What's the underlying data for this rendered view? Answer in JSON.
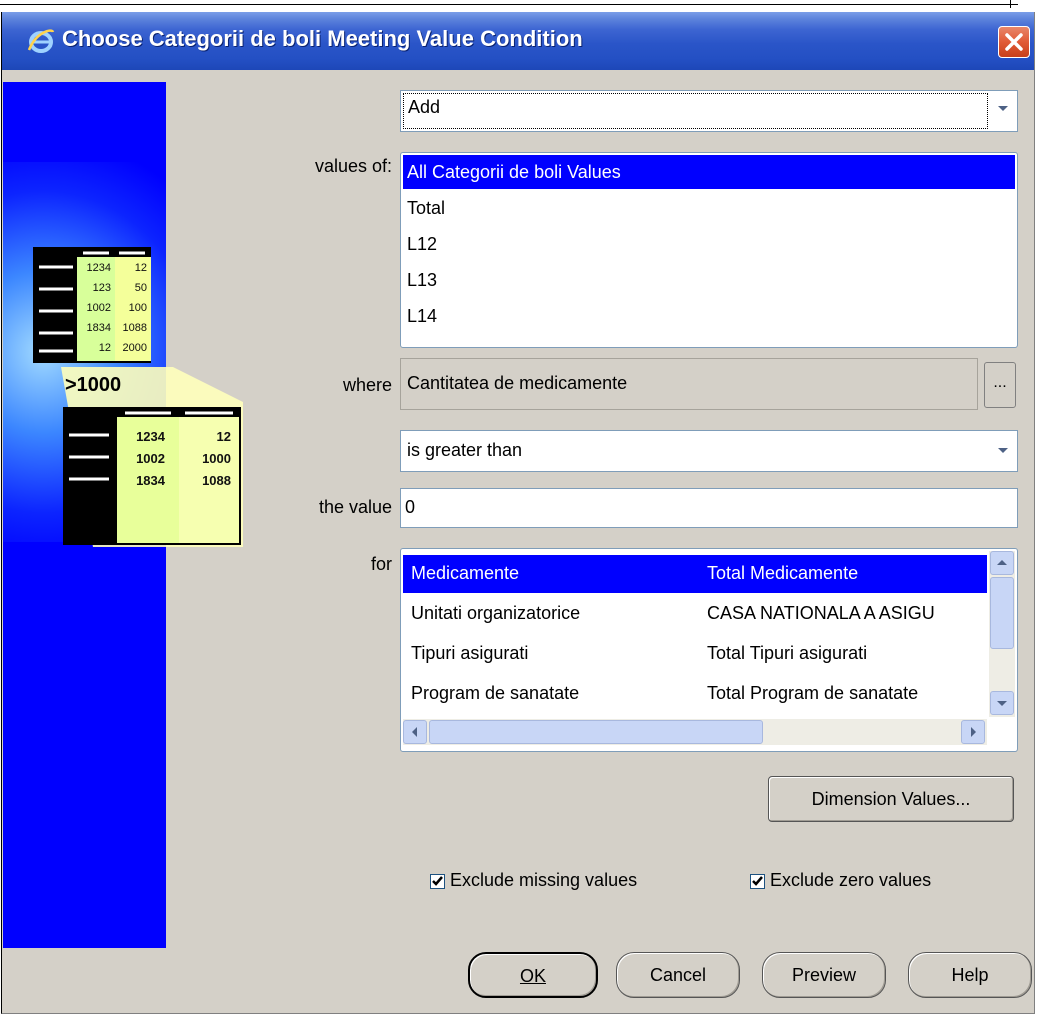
{
  "window": {
    "title": "Choose Categorii de boli Meeting Value Condition"
  },
  "illustration": {
    "threshold": ">1000",
    "top_table": [
      [
        "1234",
        "12"
      ],
      [
        "123",
        "50"
      ],
      [
        "1002",
        "100"
      ],
      [
        "1834",
        "1088"
      ],
      [
        "12",
        "2000"
      ]
    ],
    "bottom_table": [
      [
        "1234",
        "12"
      ],
      [
        "1002",
        "1000"
      ],
      [
        "1834",
        "1088"
      ]
    ]
  },
  "action": {
    "selected": "Add"
  },
  "values_of": {
    "label": "values of:",
    "items": [
      "All Categorii de boli Values",
      "Total",
      "L12",
      "L13",
      "L14"
    ],
    "selected_index": 0
  },
  "where": {
    "label": "where",
    "value": "Cantitatea de medicamente",
    "browse_label": "..."
  },
  "operator": {
    "selected": "is greater than"
  },
  "the_value": {
    "label": "the value",
    "value": "0"
  },
  "for": {
    "label": "for",
    "rows": [
      {
        "dimension": "Medicamente",
        "value": "Total Medicamente"
      },
      {
        "dimension": "Unitati organizatorice",
        "value": "CASA NATIONALA A ASIGU"
      },
      {
        "dimension": "Tipuri asigurati",
        "value": "Total Tipuri asigurati"
      },
      {
        "dimension": "Program de sanatate",
        "value": "Total Program de sanatate"
      }
    ],
    "selected_index": 0
  },
  "buttons": {
    "dimension_values": "Dimension Values...",
    "ok": "OK",
    "cancel": "Cancel",
    "preview": "Preview",
    "help": "Help"
  },
  "checkboxes": {
    "exclude_missing": {
      "label": "Exclude missing values",
      "checked": true
    },
    "exclude_zero": {
      "label": "Exclude zero values",
      "checked": true
    }
  },
  "colors": {
    "selection": "#0000ff",
    "dialog_bg": "#d4d0c8",
    "titlebar": "#2450c4"
  }
}
